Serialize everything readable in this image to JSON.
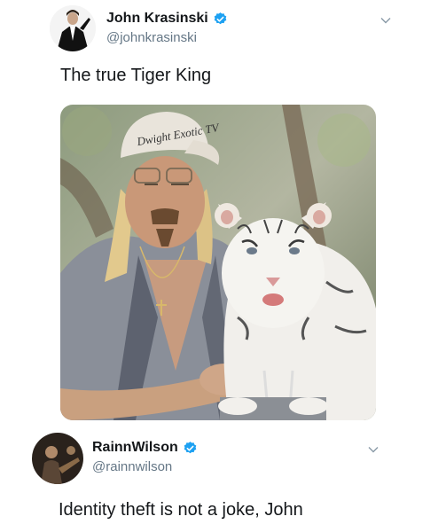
{
  "tweet1": {
    "name": "John Krasinski",
    "handle": "@johnkrasinski",
    "text": "The true Tiger King",
    "cap_text": "Dwight Exotic TV"
  },
  "tweet2": {
    "name": "RainnWilson",
    "handle": "@rainnwilson",
    "text": "Identity theft is not a joke, John"
  },
  "colors": {
    "verified": "#1da1f2",
    "secondary_text": "#657786",
    "primary_text": "#14171a"
  },
  "icons": {
    "verified": "verified-badge-icon",
    "more": "chevron-down-icon"
  }
}
